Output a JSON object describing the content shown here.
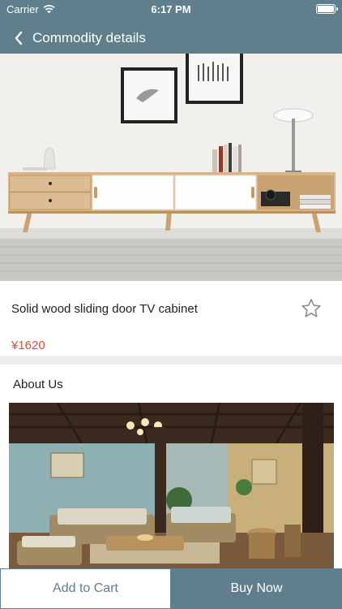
{
  "status_bar": {
    "carrier": "Carrier",
    "time": "6:17 PM",
    "wifi_icon": "wifi-icon",
    "battery_icon": "battery-icon"
  },
  "nav": {
    "back_icon": "chevron-left-icon",
    "title": "Commodity details"
  },
  "product": {
    "name": "Solid wood sliding door TV cabinet",
    "price": "¥1620",
    "favorite_icon": "star-outline-icon"
  },
  "about": {
    "title": "About Us"
  },
  "actions": {
    "add_to_cart": "Add to Cart",
    "buy_now": "Buy Now"
  },
  "colors": {
    "theme": "#5e7f8b",
    "price": "#e04a3a",
    "divider": "#ededed"
  }
}
